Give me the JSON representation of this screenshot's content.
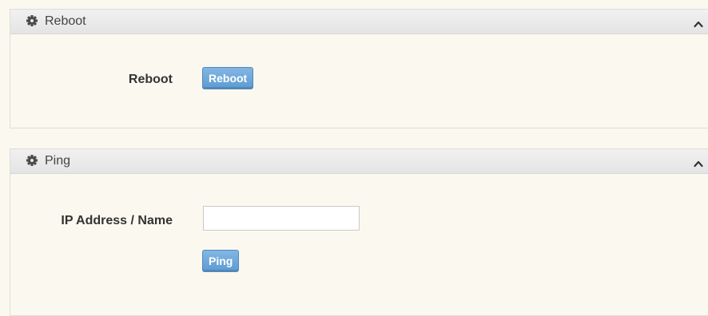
{
  "reboot_panel": {
    "title": "Reboot",
    "header_icon": "gear-icon",
    "collapse_icon": "chevron-up-icon",
    "field_label": "Reboot",
    "button_label": "Reboot"
  },
  "ping_panel": {
    "title": "Ping",
    "header_icon": "gear-icon",
    "collapse_icon": "chevron-up-icon",
    "field_label": "IP Address / Name",
    "input_value": "",
    "button_label": "Ping"
  },
  "colors": {
    "button_blue": "#5d9bd2",
    "panel_background": "#fbf9ef",
    "header_background": "#e9e9e9"
  }
}
